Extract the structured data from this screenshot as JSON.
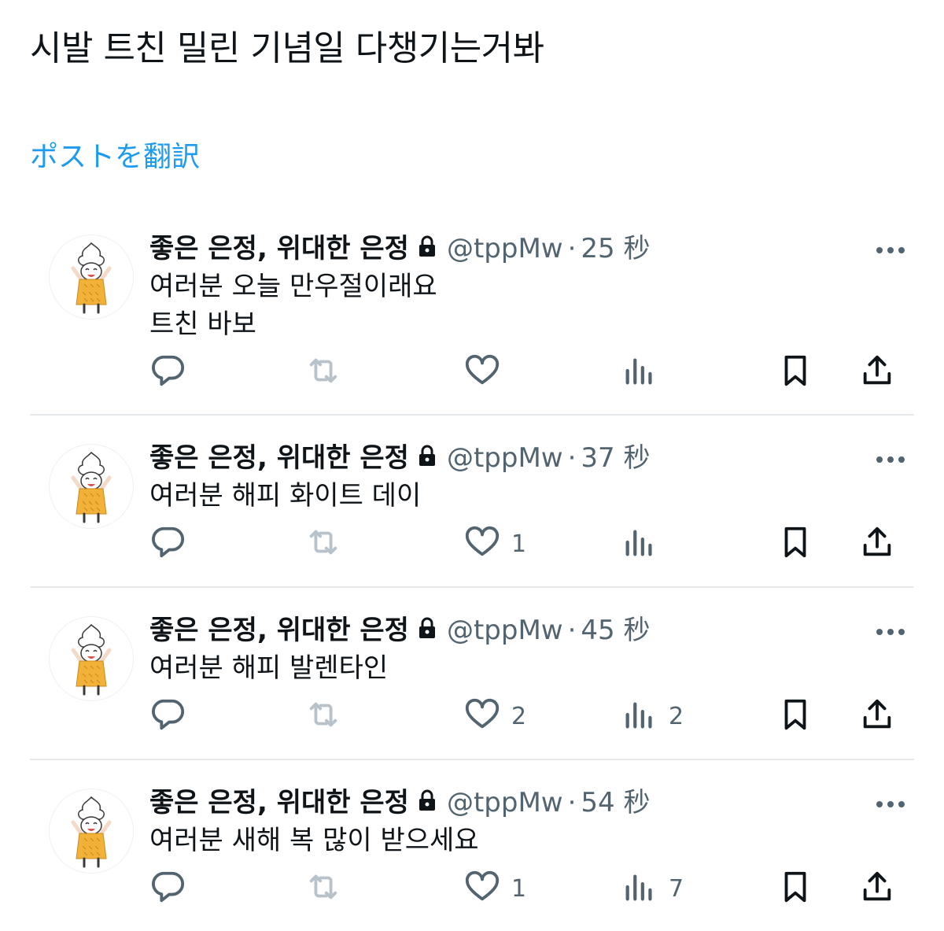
{
  "post": {
    "text": "시발 트친 밀린 기념일 다챙기는거봐",
    "translate_label": "ポストを翻訳"
  },
  "colors": {
    "link": "#1d9bf0",
    "secondary": "#536471",
    "divider": "#e6e9eb",
    "avatar_yellow": "#f2b23a"
  },
  "icons": {
    "lock": "lock-icon",
    "more": "more-icon",
    "reply": "reply-icon",
    "repost": "repost-icon",
    "like": "like-icon",
    "views": "views-icon",
    "bookmark": "bookmark-icon",
    "share": "share-icon"
  },
  "replies": [
    {
      "display_name": "좋은 은정, 위대한 은정",
      "handle": "@tppMw",
      "separator": "·",
      "time": "25 秒",
      "lines": "여러분 오늘 만우절이래요\n트친 바보",
      "like_count": "",
      "view_count": ""
    },
    {
      "display_name": "좋은 은정, 위대한 은정",
      "handle": "@tppMw",
      "separator": "·",
      "time": "37 秒",
      "lines": "여러분 해피 화이트 데이",
      "like_count": "1",
      "view_count": ""
    },
    {
      "display_name": "좋은 은정, 위대한 은정",
      "handle": "@tppMw",
      "separator": "·",
      "time": "45 秒",
      "lines": "여러분 해피 발렌타인",
      "like_count": "2",
      "view_count": "2"
    },
    {
      "display_name": "좋은 은정, 위대한 은정",
      "handle": "@tppMw",
      "separator": "·",
      "time": "54 秒",
      "lines": "여러분 새해 복 많이 받으세요",
      "like_count": "1",
      "view_count": "7"
    }
  ]
}
